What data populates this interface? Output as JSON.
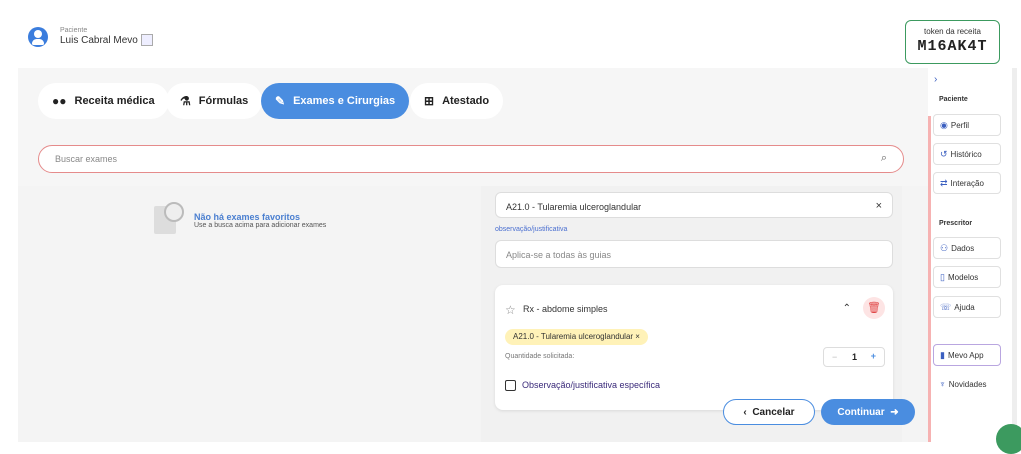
{
  "patient": {
    "label": "Paciente",
    "name": "Luis Cabral Mevo"
  },
  "token": {
    "label": "token da receita",
    "value": "M16AK4T"
  },
  "tabs": [
    {
      "label": "Receita médica",
      "icon": "pills-icon"
    },
    {
      "label": "Fórmulas",
      "icon": "flask-icon"
    },
    {
      "label": "Exames e Cirurgias",
      "icon": "pen-icon"
    },
    {
      "label": "Atestado",
      "icon": "document-plus-icon"
    }
  ],
  "search": {
    "placeholder": "Buscar exames"
  },
  "empty": {
    "title": "Não há exames favoritos",
    "subtitle": "Use a busca acima para adicionar exames"
  },
  "diagnosis": {
    "value": "A21.0 - Tularemia ulceroglandular"
  },
  "observation": {
    "label": "observação/justificativa",
    "placeholder": "Aplica-se a todas às guias"
  },
  "exam": {
    "name": "Rx - abdome simples",
    "chip": "A21.0 - Tularemia ulceroglandular",
    "qty_label": "Quantidade solicitada:",
    "qty": "1",
    "obs_label": "Observação/justificativa específica"
  },
  "actions": {
    "cancel": "Cancelar",
    "continue": "Continuar"
  },
  "sidebar": {
    "paciente": "Paciente",
    "perfil": "Perfil",
    "historico": "Histórico",
    "interacao": "Interação",
    "prescritor": "Prescritor",
    "dados": "Dados",
    "modelos": "Modelos",
    "ajuda": "Ajuda",
    "mevo_app": "Mevo App",
    "novidades": "Novidades"
  }
}
